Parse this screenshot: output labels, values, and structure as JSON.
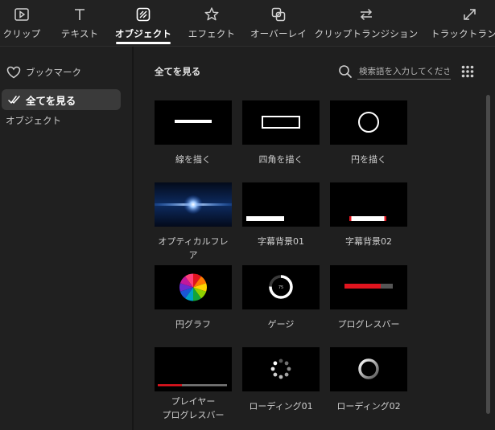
{
  "tabs": [
    {
      "label": "クリップ",
      "icon": "clip-icon",
      "active": false
    },
    {
      "label": "テキスト",
      "icon": "text-icon",
      "active": false
    },
    {
      "label": "オブジェクト",
      "icon": "object-icon",
      "active": true
    },
    {
      "label": "エフェクト",
      "icon": "effect-icon",
      "active": false
    },
    {
      "label": "オーバーレイ",
      "icon": "overlay-icon",
      "active": false
    },
    {
      "label": "クリップトランジション",
      "icon": "clip-transition-icon",
      "active": false
    },
    {
      "label": "トラックトランジシ",
      "icon": "track-transition-icon",
      "active": false
    }
  ],
  "sidebar": {
    "bookmark_label": "ブックマーク",
    "all_label": "全てを見る",
    "category_label": "オブジェクト"
  },
  "main": {
    "title": "全てを見る",
    "search_placeholder": "検索語を入力してください。"
  },
  "items": [
    {
      "label": "線を描く",
      "thumb": "line"
    },
    {
      "label": "四角を描く",
      "thumb": "rect"
    },
    {
      "label": "円を描く",
      "thumb": "circle"
    },
    {
      "label": "オプティカルフレア",
      "thumb": "flare"
    },
    {
      "label": "字幕背景01",
      "thumb": "sub1"
    },
    {
      "label": "字幕背景02",
      "thumb": "sub2"
    },
    {
      "label": "円グラフ",
      "thumb": "pie"
    },
    {
      "label": "ゲージ",
      "thumb": "gauge",
      "gauge_value": "75"
    },
    {
      "label": "プログレスバー",
      "thumb": "progress"
    },
    {
      "label": "プレイヤー\nプログレスバー",
      "thumb": "player"
    },
    {
      "label": "ローディング01",
      "thumb": "load1"
    },
    {
      "label": "ローディング02",
      "thumb": "load2"
    }
  ],
  "colors": {
    "accent_red": "#e0141e",
    "active_bg": "#3a3a3a",
    "flare_blue": "#3d8cff"
  }
}
